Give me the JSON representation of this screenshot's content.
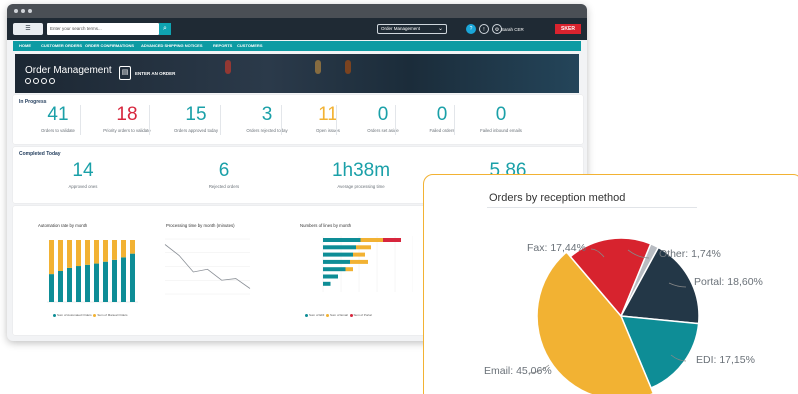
{
  "header": {
    "search_placeholder": "Enter your search terms...",
    "module_select": "Order Management",
    "user_name": "Sarah CER",
    "brand": "SKER"
  },
  "nav": {
    "items": [
      "HOME",
      "CUSTOMER ORDERS",
      "ORDER CONFIRMATIONS",
      "ADVANCED SHIPPING NOTICES",
      "REPORTS",
      "CUSTOMERS"
    ]
  },
  "banner": {
    "title": "Order Management",
    "enter_label": "ENTER AN ORDER"
  },
  "in_progress": {
    "title": "In Progress",
    "stats": [
      {
        "value": "41",
        "label": "Orders to validate",
        "color": "#1aa0a8"
      },
      {
        "value": "18",
        "label": "Priority orders to validate",
        "color": "#d7263d"
      },
      {
        "value": "15",
        "label": "Orders approved today",
        "color": "#1aa0a8"
      },
      {
        "value": "3",
        "label": "Orders rejected today",
        "color": "#1aa0a8"
      },
      {
        "value": "11",
        "label": "Open issues",
        "color": "#f2b233"
      },
      {
        "value": "0",
        "label": "Orders set aside",
        "color": "#1aa0a8"
      },
      {
        "value": "0",
        "label": "Failed orders",
        "color": "#1aa0a8"
      },
      {
        "value": "0",
        "label": "Failed inbound emails",
        "color": "#1aa0a8"
      }
    ]
  },
  "completed_today": {
    "title": "Completed Today",
    "stats": [
      {
        "value": "14",
        "label": "Approved ones"
      },
      {
        "value": "6",
        "label": "Rejected orders"
      },
      {
        "value": "1h38m",
        "label": "Average processing time"
      },
      {
        "value": "5.86",
        "label": ""
      }
    ]
  },
  "mini_charts": {
    "automation": {
      "title": "Automation rate by month",
      "legend": [
        "Sum of Automated Orders",
        "Sum of Manual Orders"
      ],
      "automated": [
        45,
        50,
        55,
        58,
        60,
        62,
        65,
        68,
        72,
        78
      ],
      "manual": [
        55,
        50,
        45,
        42,
        40,
        38,
        35,
        32,
        28,
        22
      ],
      "colors": [
        "#0e8d96",
        "#f2b233"
      ]
    },
    "processing": {
      "title": "Processing time by month (minutes)",
      "values": [
        90,
        70,
        40,
        45,
        25,
        28,
        10
      ]
    },
    "lines": {
      "title": "Numbers of lines by month",
      "legend": [
        "Sum of EDI",
        "Sum of Email",
        "Sum of Portal"
      ],
      "colors": [
        "#0e8d96",
        "#f2b233",
        "#d7263d"
      ],
      "rows": [
        [
          25,
          15,
          12
        ],
        [
          22,
          10,
          0
        ],
        [
          20,
          8,
          0
        ],
        [
          18,
          12,
          0
        ],
        [
          15,
          5,
          0
        ],
        [
          10,
          0,
          0
        ],
        [
          5,
          0,
          0
        ]
      ]
    }
  },
  "chart_data": {
    "type": "pie",
    "title": "Orders by reception method",
    "slices": [
      {
        "label": "Other",
        "value": 1.74,
        "display": "Other: 1,74%",
        "color": "#b8bcc2"
      },
      {
        "label": "Portal",
        "value": 18.6,
        "display": "Portal: 18,60%",
        "color": "#233747"
      },
      {
        "label": "EDI",
        "value": 17.15,
        "display": "EDI: 17,15%",
        "color": "#0e8d96"
      },
      {
        "label": "Email",
        "value": 45.06,
        "display": "Email: 45,06%",
        "color": "#f2b233"
      },
      {
        "label": "Fax",
        "value": 17.44,
        "display": "Fax: 17,44%",
        "color": "#d7232e"
      }
    ]
  }
}
